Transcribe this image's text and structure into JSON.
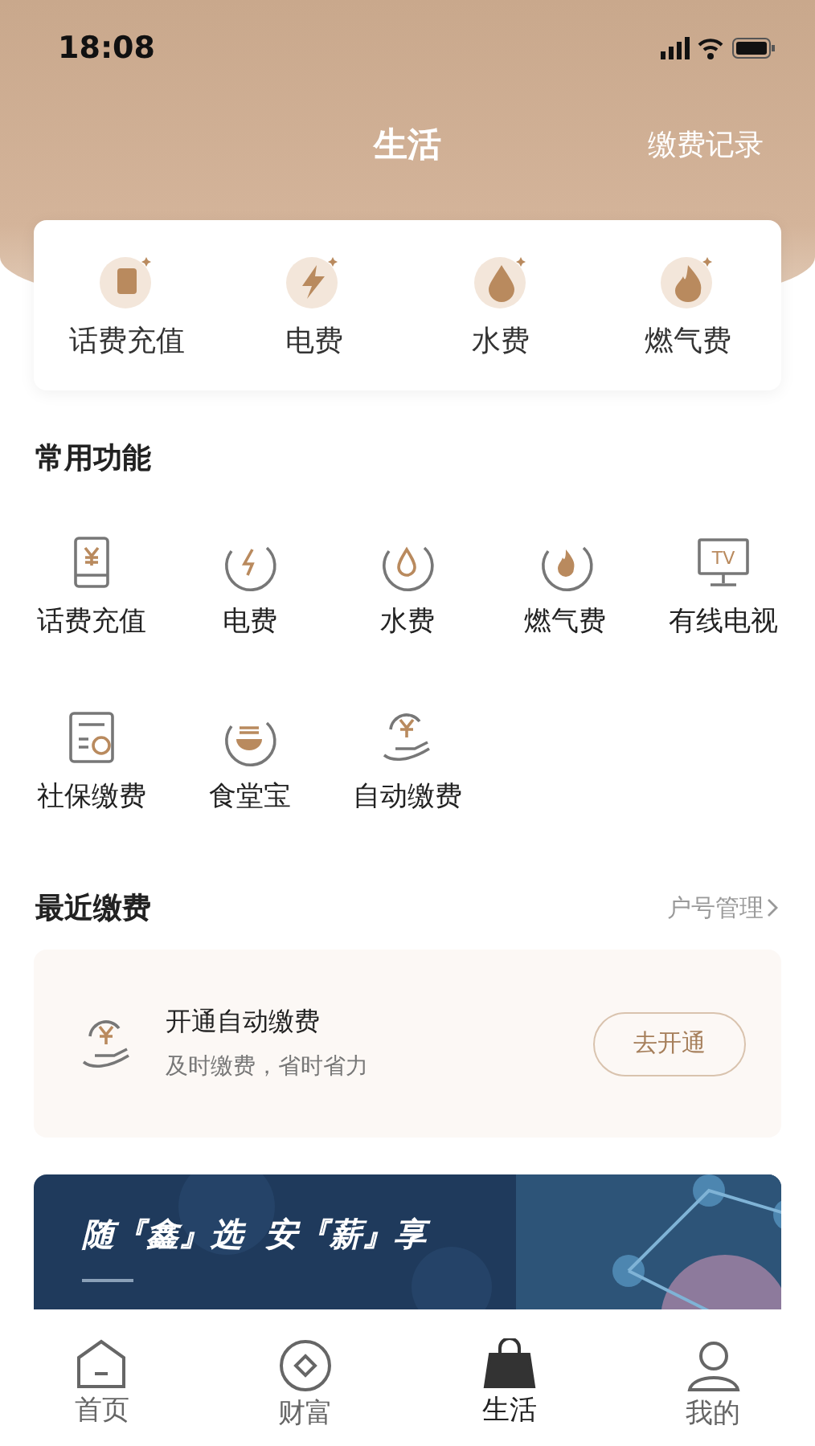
{
  "status_bar": {
    "time": "18:08"
  },
  "header": {
    "title": "生活",
    "action": "缴费记录"
  },
  "quick": [
    {
      "label": "话费充值",
      "kind": "phone"
    },
    {
      "label": "电费",
      "kind": "bolt"
    },
    {
      "label": "水费",
      "kind": "drop"
    },
    {
      "label": "燃气费",
      "kind": "flame"
    }
  ],
  "functions": {
    "title": "常用功能",
    "items": [
      {
        "label": "话费充值",
        "kind": "phone"
      },
      {
        "label": "电费",
        "kind": "bolt"
      },
      {
        "label": "水费",
        "kind": "drop"
      },
      {
        "label": "燃气费",
        "kind": "flame"
      },
      {
        "label": "有线电视",
        "kind": "tv",
        "badge": "TV"
      },
      {
        "label": "社保缴费",
        "kind": "doc"
      },
      {
        "label": "食堂宝",
        "kind": "bowl"
      },
      {
        "label": "自动缴费",
        "kind": "hand"
      }
    ]
  },
  "recent": {
    "title": "最近缴费",
    "link": "户号管理",
    "card": {
      "title": "开通自动缴费",
      "subtitle": "及时缴费，省时省力",
      "button": "去开通"
    }
  },
  "banner": {
    "headline": "随『鑫』选  安『薪』享"
  },
  "tabbar": [
    {
      "label": "首页",
      "kind": "home",
      "selected": false
    },
    {
      "label": "财富",
      "kind": "coin",
      "selected": false
    },
    {
      "label": "生活",
      "kind": "bag",
      "selected": true
    },
    {
      "label": "我的",
      "kind": "user",
      "selected": false
    }
  ]
}
